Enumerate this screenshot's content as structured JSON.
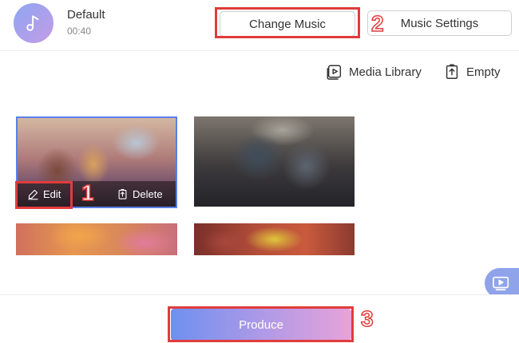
{
  "music": {
    "title": "Default",
    "duration": "00:40",
    "change_label": "Change Music",
    "settings_label": "Music Settings"
  },
  "toolbar": {
    "media_library_label": "Media Library",
    "empty_label": "Empty"
  },
  "clips": [
    {
      "edit_label": "Edit",
      "delete_label": "Delete",
      "selected": true
    },
    {
      "selected": false
    },
    {
      "selected": false
    },
    {
      "selected": false
    }
  ],
  "footer": {
    "produce_label": "Produce"
  },
  "steps": {
    "one": "1",
    "two": "2",
    "three": "3"
  },
  "colors": {
    "accent_gradient_start": "#6e90f0",
    "accent_gradient_end": "#e7a3d8",
    "highlight_red": "#e03c3c",
    "selection_blue": "#5b7fe8"
  },
  "icons": {
    "music": "music-note-icon",
    "media_library": "media-library-icon",
    "empty": "trash-icon",
    "edit": "pencil-icon",
    "delete": "trash-icon",
    "preview": "preview-icon"
  }
}
